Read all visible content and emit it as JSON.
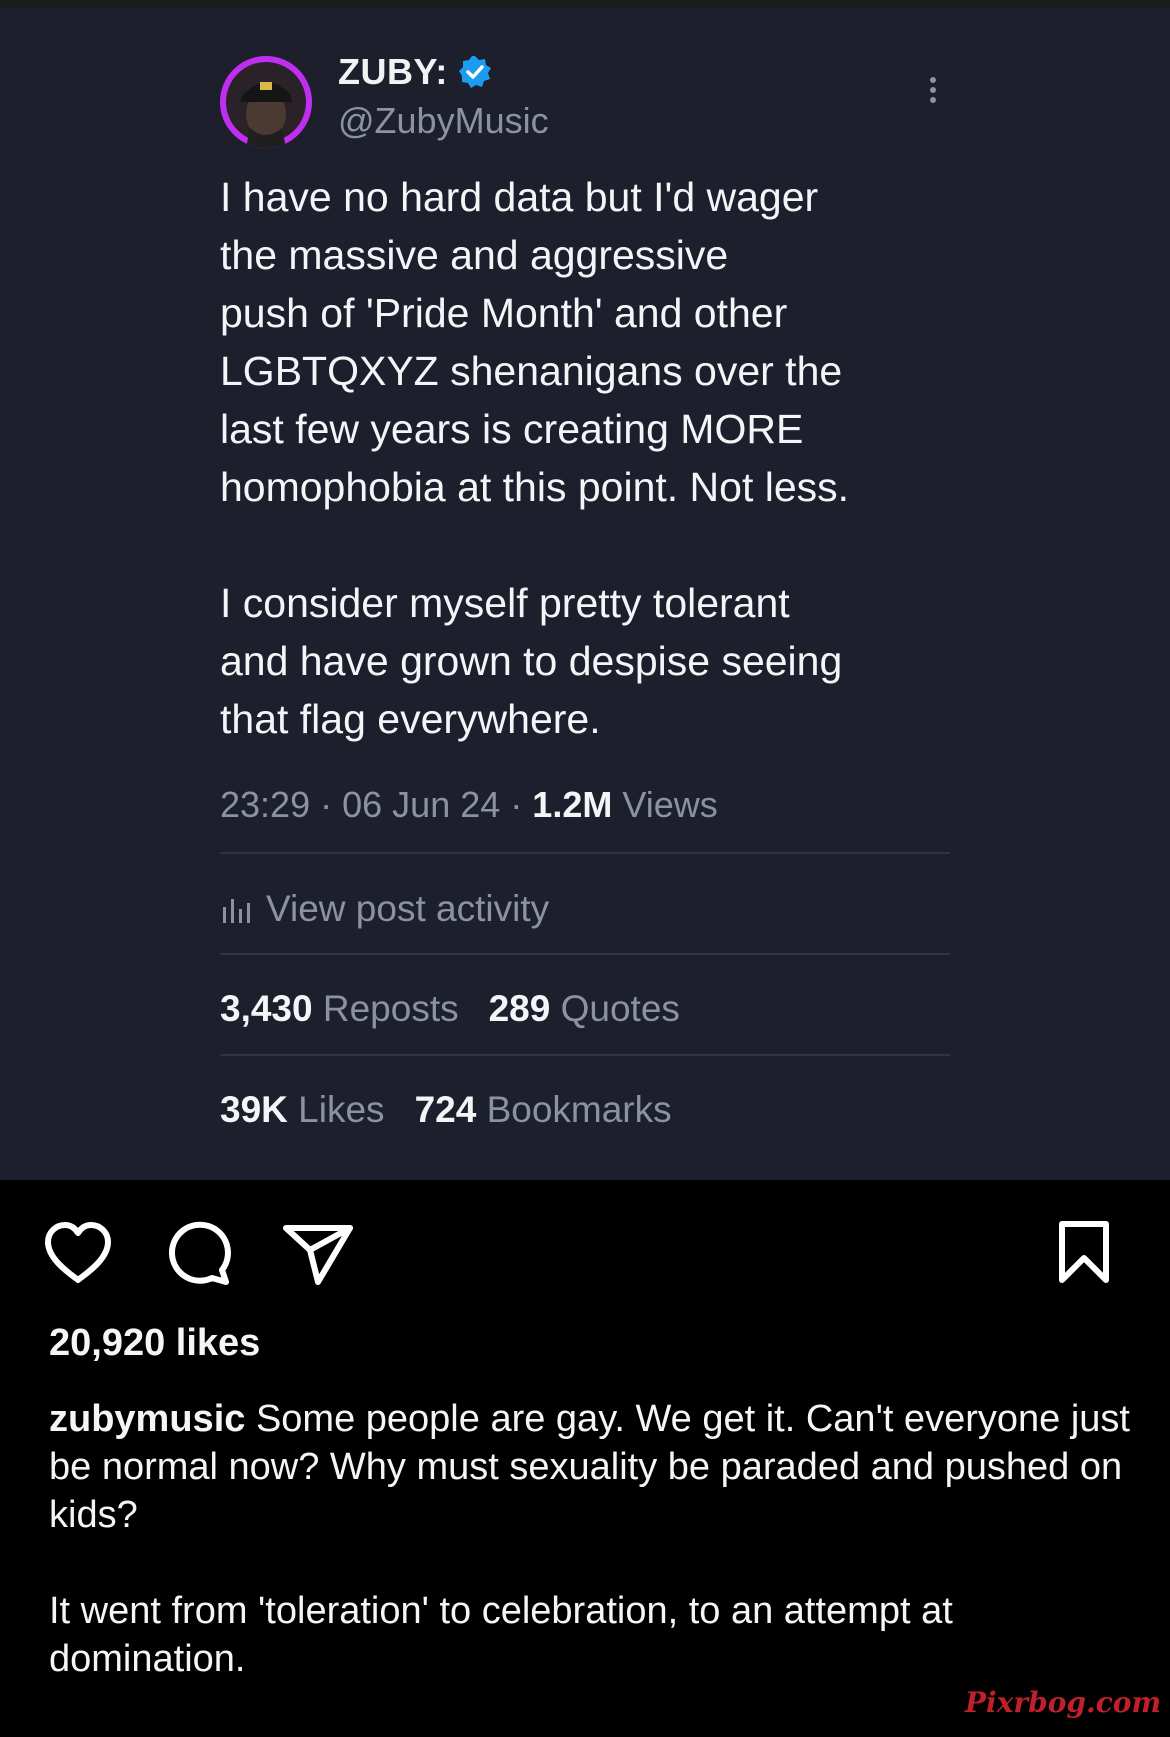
{
  "tweet": {
    "display_name": "ZUBY:",
    "handle": "@ZubyMusic",
    "text": "I have no hard data but I'd wager\nthe massive and aggressive\npush of 'Pride Month' and other\nLGBTQXYZ shenanigans over the\nlast few years is creating MORE\nhomophobia at this point. Not less.\n\nI consider myself pretty tolerant\nand have grown to despise seeing\nthat flag everywhere.",
    "time": "23:29",
    "date": "06 Jun 24",
    "views_count": "1.2M",
    "views_label": "Views",
    "separator": "·",
    "activity_label": "View post activity",
    "reposts_count": "3,430",
    "reposts_label": "Reposts",
    "quotes_count": "289",
    "quotes_label": "Quotes",
    "likes_count": "39K",
    "likes_label": "Likes",
    "bookmarks_count": "724",
    "bookmarks_label": "Bookmarks",
    "colors": {
      "card_bg": "#1d1f2c",
      "verified": "#1d9bf0",
      "muted": "#8b93a3"
    }
  },
  "post": {
    "likes": "20,920 likes",
    "username": "zubymusic",
    "caption_1": " Some people are gay. We get it. Can't everyone just be normal now? Why must sexuality be paraded and pushed on kids?",
    "caption_2": "It went from 'toleration' to celebration, to an attempt at domination.",
    "icons": [
      "heart-icon",
      "comment-icon",
      "share-icon",
      "bookmark-icon"
    ]
  },
  "watermark": "Pixrbog.com"
}
